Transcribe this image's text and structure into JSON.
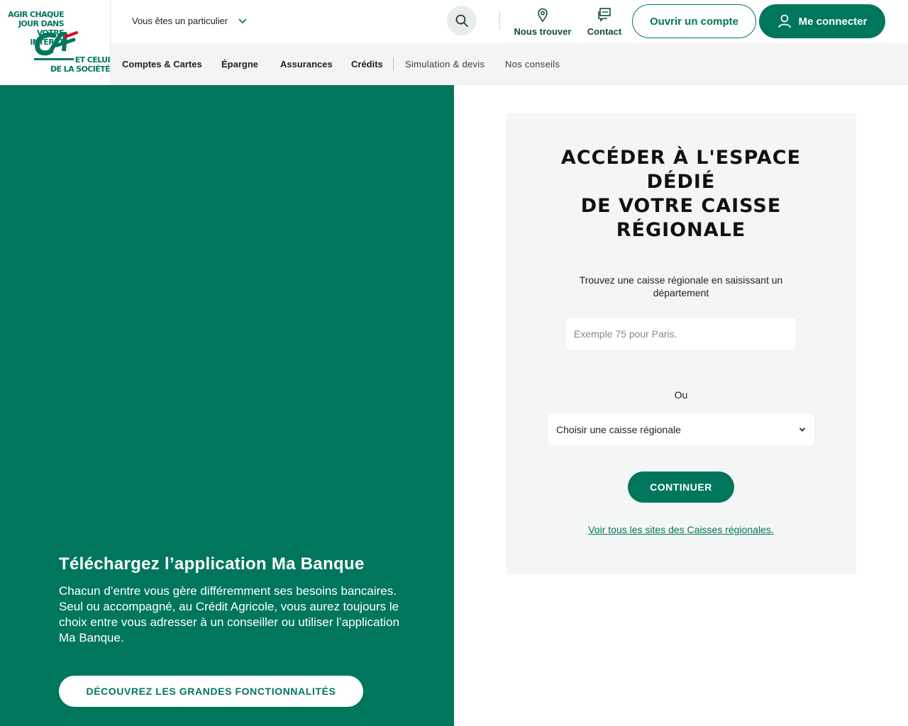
{
  "brand": {
    "slogan_top": "AGIR CHAQUE\nJOUR DANS VOTRE\nINTÉRÊT",
    "slogan_bottom": "ET CELUI\nDE LA SOCIÉTÉ",
    "logo_icon": "ca-logo",
    "colors": {
      "green": "#00775d",
      "red": "#e2001a",
      "light_bg": "#f4f5f5"
    }
  },
  "header": {
    "profile_label": "Vous êtes un particulier",
    "search_icon": "search-icon",
    "find_label": "Nous trouver",
    "contact_label": "Contact",
    "open_account_label": "Ouvrir un compte",
    "login_label": "Me connecter"
  },
  "nav": {
    "items": [
      {
        "label": "Comptes & Cartes"
      },
      {
        "label": "Épargne"
      },
      {
        "label": "Assurances"
      },
      {
        "label": "Crédits"
      },
      {
        "label": "Simulation & devis"
      },
      {
        "label": "Nos conseils"
      }
    ]
  },
  "promo": {
    "title": "Téléchargez l’application Ma Banque",
    "paragraph1": "Chacun d’entre vous gère différemment ses besoins bancaires.",
    "paragraph2": "Seul ou accompagné, au Crédit Agricole, vous aurez toujours le choix entre vous adresser à  un conseiller ou utiliser l’application Ma Banque.",
    "button_label": "DÉCOUVREZ LES GRANDES FONCTIONNALITÉS"
  },
  "card": {
    "title_lines": [
      "ACCÉDER À L'ESPACE",
      "DÉDIÉ",
      "DE VOTRE CAISSE",
      "RÉGIONALE"
    ],
    "description": "Trouvez une caisse régionale en saisissant un département",
    "input_value": "",
    "input_placeholder": "Exemple 75 pour Paris.",
    "or_label": "Ou",
    "select_value": "Choisir une caisse régionale",
    "continue_label": "CONTINUER",
    "all_sites_link": "Voir tous les sites des Caisses régionales."
  }
}
